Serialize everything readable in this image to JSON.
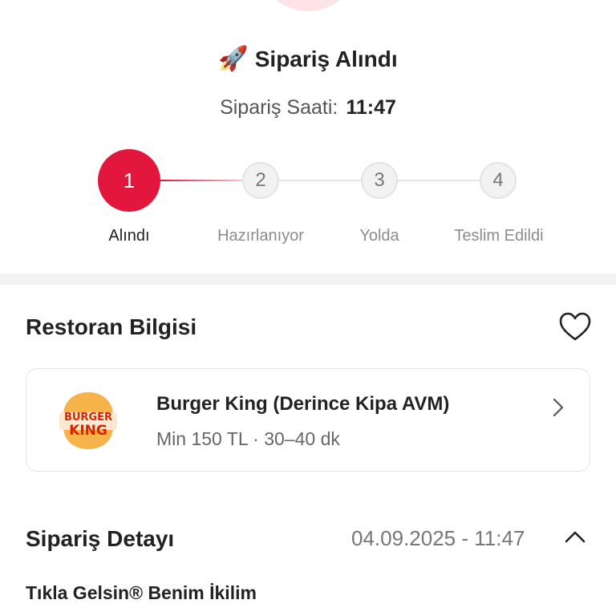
{
  "status": {
    "emoji": "🚀",
    "title": "Sipariş Alındı",
    "time_label": "Sipariş Saati:",
    "time_value": "11:47"
  },
  "steps": [
    {
      "number": "1",
      "label": "Alındı",
      "active": true
    },
    {
      "number": "2",
      "label": "Hazırlanıyor",
      "active": false
    },
    {
      "number": "3",
      "label": "Yolda",
      "active": false
    },
    {
      "number": "4",
      "label": "Teslim Edildi",
      "active": false
    }
  ],
  "restaurant_section": {
    "title": "Restoran Bilgisi",
    "heart_icon": "heart-outline-icon",
    "restaurant": {
      "name": "Burger King (Derince Kipa AVM)",
      "meta": "Min 150 TL · 30–40 dk",
      "logo_text_top": "BURGER",
      "logo_text_bottom": "KING"
    }
  },
  "order_detail": {
    "title": "Sipariş Detayı",
    "date": "04.09.2025 - 11:47",
    "collapse_icon": "chevron-up-icon",
    "first_item": "Tıkla Gelsin® Benim İkilim"
  },
  "colors": {
    "accent": "#e3173e",
    "divider": "#f2f2f2",
    "bk_orange": "#f5b34a",
    "bk_red": "#d72300"
  }
}
